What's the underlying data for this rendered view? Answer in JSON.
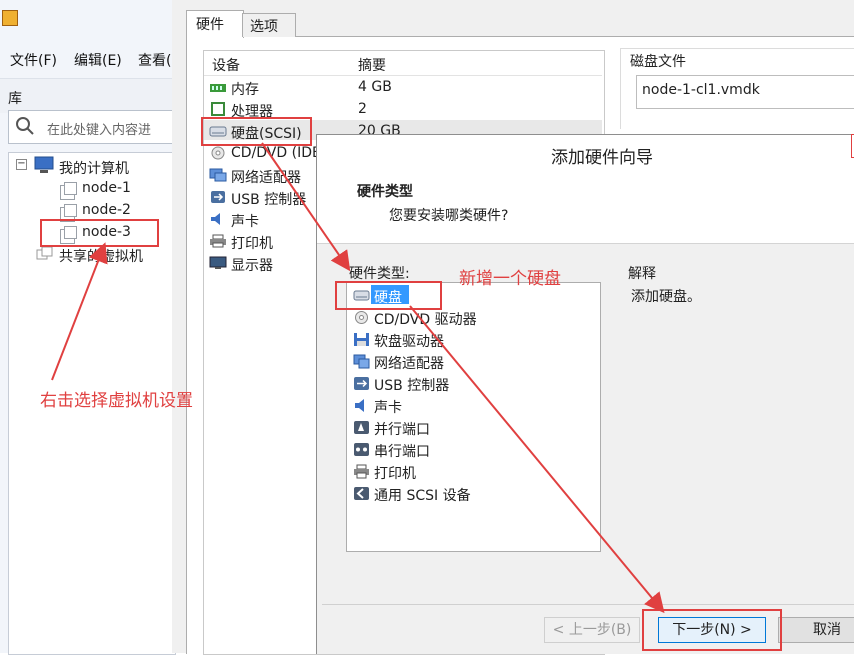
{
  "menu": [
    "文件(F)",
    "编辑(E)",
    "查看("
  ],
  "library": {
    "label": "库",
    "search_placeholder": "在此处键入内容进",
    "tree": {
      "root": "我的计算机",
      "vms": [
        "node-1",
        "node-2",
        "node-3"
      ],
      "shared": "共享的虚拟机"
    }
  },
  "settings": {
    "tabs": [
      "硬件",
      "选项"
    ],
    "columns": {
      "device": "设备",
      "summary": "摘要"
    },
    "devices": [
      {
        "name": "内存",
        "summary": "4 GB"
      },
      {
        "name": "处理器",
        "summary": "2"
      },
      {
        "name": "硬盘(SCSI)",
        "summary": "20 GB"
      },
      {
        "name": "CD/DVD (IDE",
        "summary": ""
      },
      {
        "name": "网络适配器",
        "summary": ""
      },
      {
        "name": "USB 控制器",
        "summary": ""
      },
      {
        "name": "声卡",
        "summary": ""
      },
      {
        "name": "打印机",
        "summary": ""
      },
      {
        "name": "显示器",
        "summary": ""
      }
    ],
    "disk_file": {
      "label": "磁盘文件",
      "value": "node-1-cl1.vmdk"
    }
  },
  "wizard": {
    "title": "添加硬件向导",
    "heading": "硬件类型",
    "subheading": "您要安装哪类硬件?",
    "list_label": "硬件类型:",
    "items": [
      "硬盘",
      "CD/DVD 驱动器",
      "软盘驱动器",
      "网络适配器",
      "USB 控制器",
      "声卡",
      "并行端口",
      "串行端口",
      "打印机",
      "通用 SCSI 设备"
    ],
    "explain_label": "解释",
    "explain_text": "添加硬盘。",
    "buttons": {
      "back": "< 上一步(B)",
      "next": "下一步(N) >",
      "cancel": "取消"
    }
  },
  "annotations": {
    "right_click_note": "右击选择虚拟机设置",
    "add_disk_note": "新增一个硬盘"
  },
  "colors": {
    "annotation": "#e04040",
    "selection": "#3399ff"
  }
}
